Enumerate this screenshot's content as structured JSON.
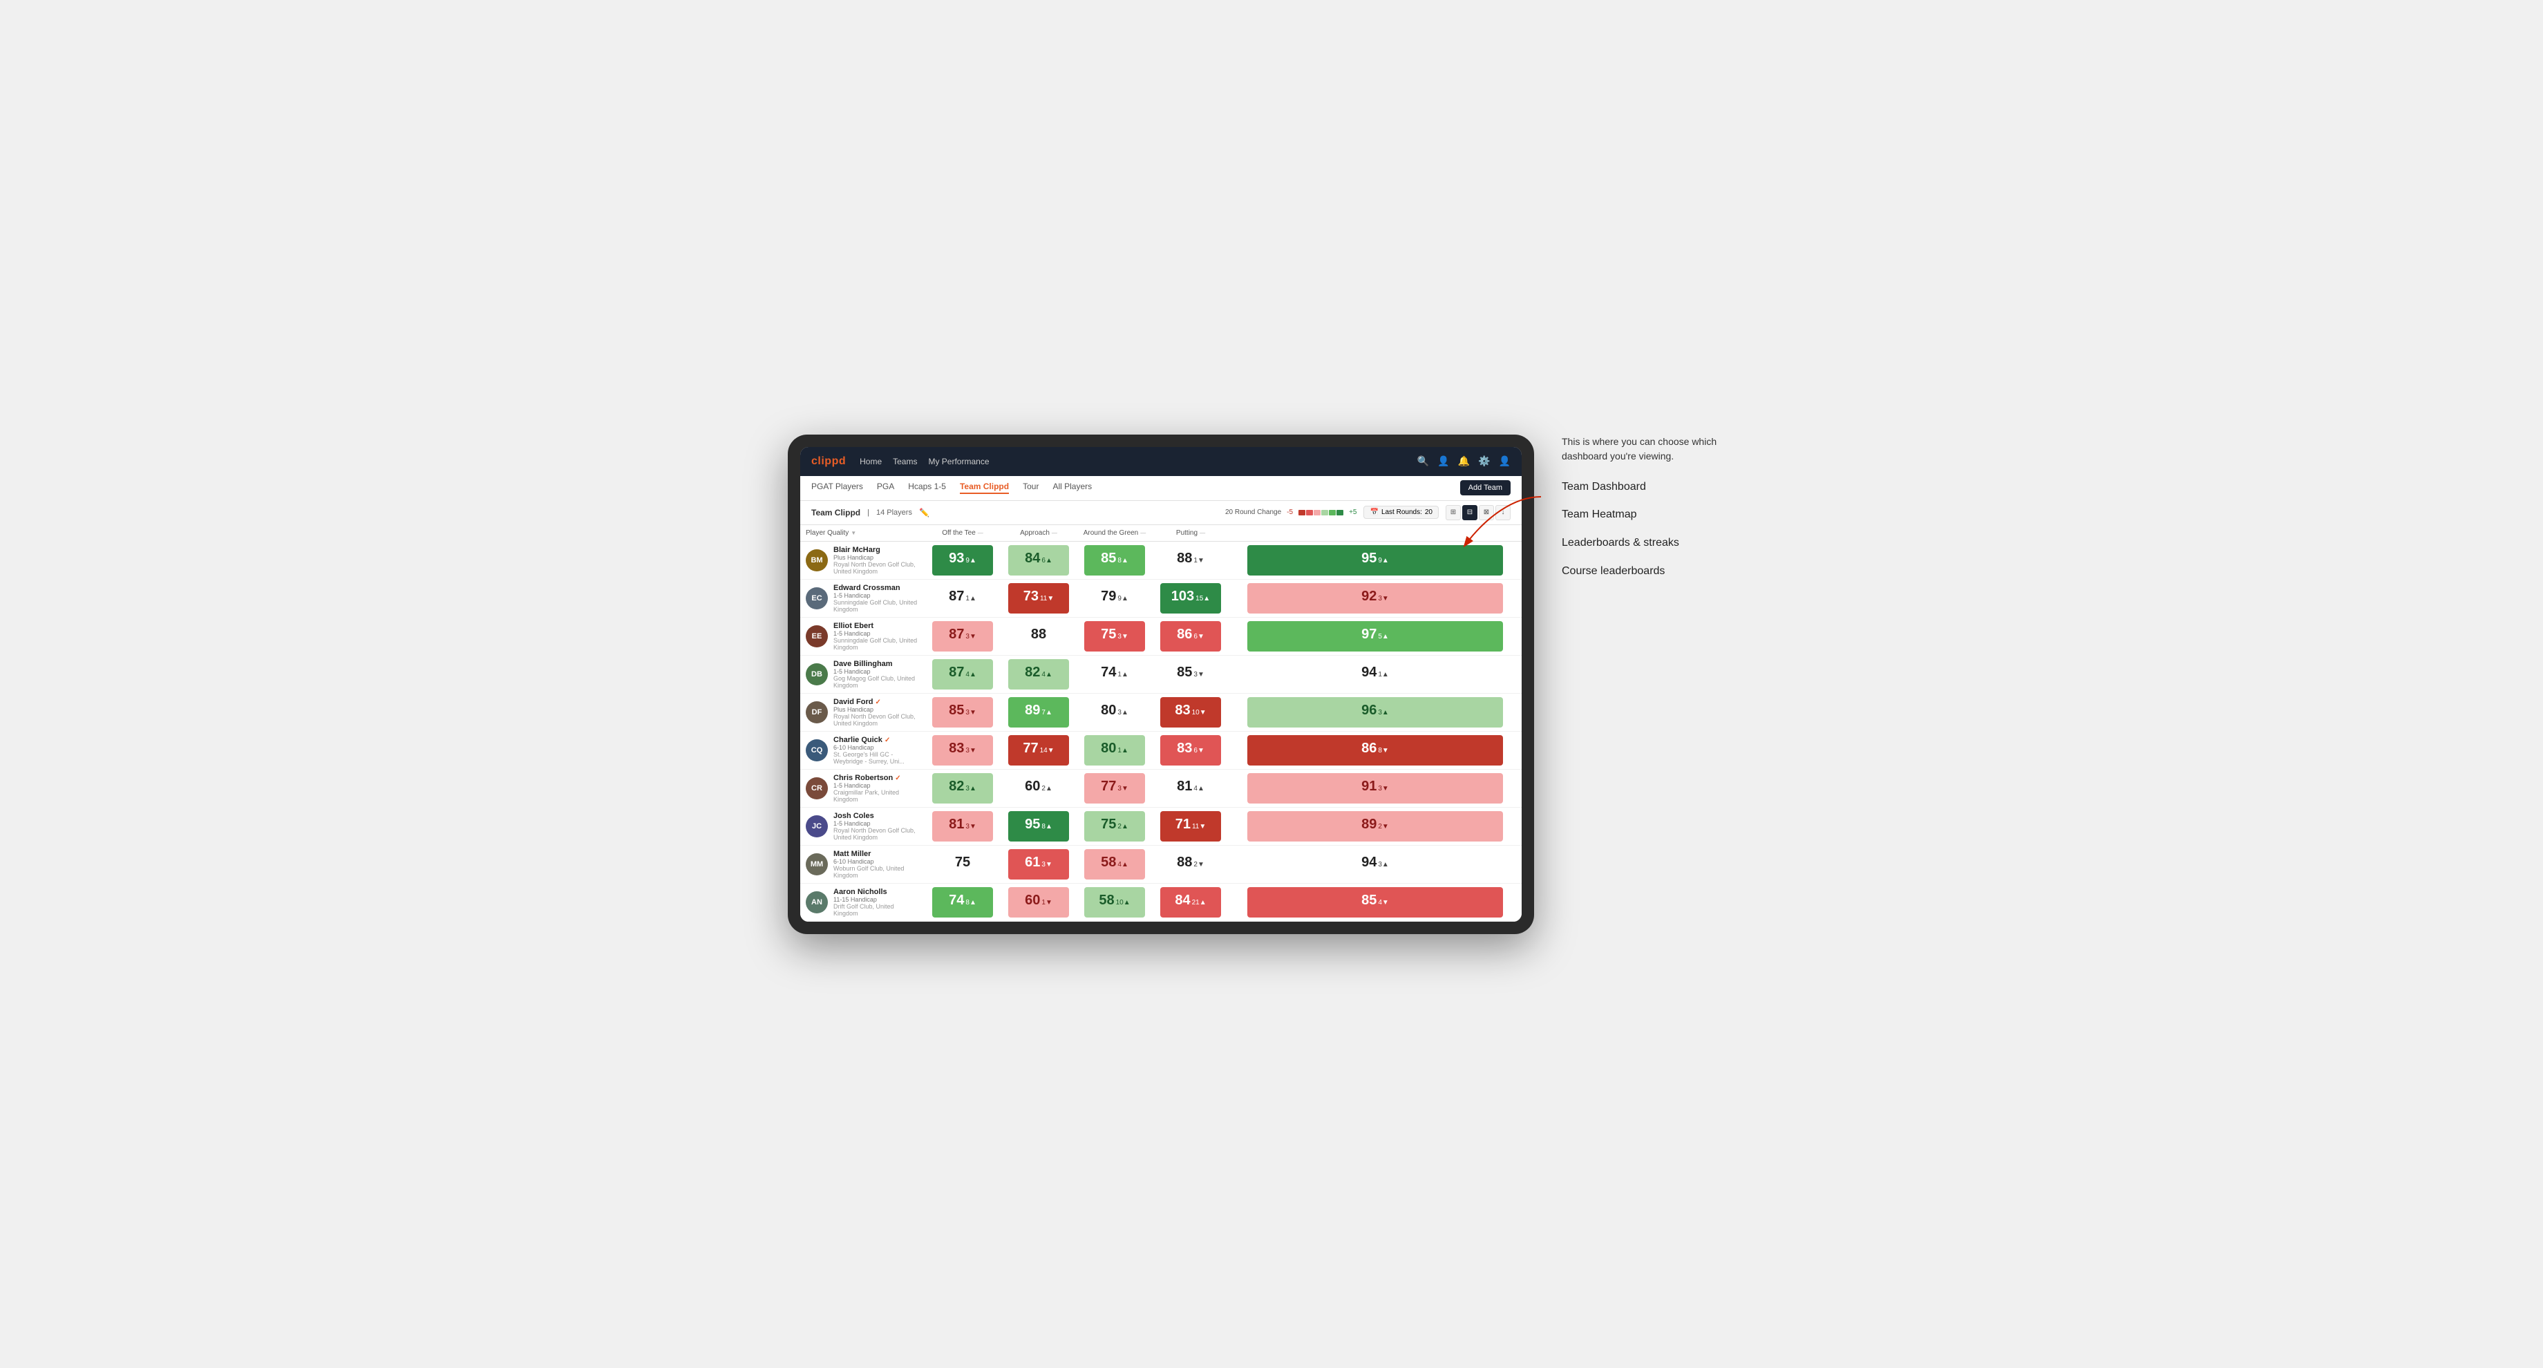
{
  "app": {
    "logo": "clippd",
    "nav": {
      "links": [
        "Home",
        "Teams",
        "My Performance"
      ],
      "icons": [
        "search",
        "user",
        "bell",
        "settings",
        "avatar"
      ]
    },
    "sub_nav": {
      "links": [
        "PGAT Players",
        "PGA",
        "Hcaps 1-5",
        "Team Clippd",
        "Tour",
        "All Players"
      ],
      "active": "Team Clippd",
      "add_button": "Add Team"
    }
  },
  "team_header": {
    "name": "Team Clippd",
    "separator": "|",
    "count": "14 Players",
    "round_change_label": "20 Round Change",
    "round_change_low": "-5",
    "round_change_high": "+5",
    "last_rounds_label": "Last Rounds:",
    "last_rounds_value": "20"
  },
  "table": {
    "columns": [
      {
        "id": "player",
        "label": "Player Quality",
        "sortable": true
      },
      {
        "id": "off_tee",
        "label": "Off the Tee",
        "sortable": true
      },
      {
        "id": "approach",
        "label": "Approach",
        "sortable": true
      },
      {
        "id": "around_green",
        "label": "Around the Green",
        "sortable": true
      },
      {
        "id": "putting",
        "label": "Putting",
        "sortable": true
      }
    ],
    "rows": [
      {
        "name": "Blair McHarg",
        "handicap": "Plus Handicap",
        "club": "Royal North Devon Golf Club, United Kingdom",
        "initials": "BM",
        "avatar_color": "#8B6914",
        "scores": [
          {
            "value": "93",
            "delta": "9",
            "dir": "up",
            "color": "bg-green-strong"
          },
          {
            "value": "84",
            "delta": "6",
            "dir": "up",
            "color": "bg-green-light"
          },
          {
            "value": "85",
            "delta": "8",
            "dir": "up",
            "color": "bg-green-mid"
          },
          {
            "value": "88",
            "delta": "1",
            "dir": "down",
            "color": "bg-white"
          },
          {
            "value": "95",
            "delta": "9",
            "dir": "up",
            "color": "bg-green-strong"
          }
        ]
      },
      {
        "name": "Edward Crossman",
        "handicap": "1-5 Handicap",
        "club": "Sunningdale Golf Club, United Kingdom",
        "initials": "EC",
        "avatar_color": "#5a6a7a",
        "scores": [
          {
            "value": "87",
            "delta": "1",
            "dir": "up",
            "color": "bg-white"
          },
          {
            "value": "73",
            "delta": "11",
            "dir": "down",
            "color": "bg-red-strong"
          },
          {
            "value": "79",
            "delta": "9",
            "dir": "up",
            "color": "bg-white"
          },
          {
            "value": "103",
            "delta": "15",
            "dir": "up",
            "color": "bg-green-strong"
          },
          {
            "value": "92",
            "delta": "3",
            "dir": "down",
            "color": "bg-red-light"
          }
        ]
      },
      {
        "name": "Elliot Ebert",
        "handicap": "1-5 Handicap",
        "club": "Sunningdale Golf Club, United Kingdom",
        "initials": "EE",
        "avatar_color": "#7a3a2a",
        "scores": [
          {
            "value": "87",
            "delta": "3",
            "dir": "down",
            "color": "bg-red-light"
          },
          {
            "value": "88",
            "delta": "",
            "dir": "",
            "color": "bg-white"
          },
          {
            "value": "75",
            "delta": "3",
            "dir": "down",
            "color": "bg-red-mid"
          },
          {
            "value": "86",
            "delta": "6",
            "dir": "down",
            "color": "bg-red-mid"
          },
          {
            "value": "97",
            "delta": "5",
            "dir": "up",
            "color": "bg-green-mid"
          }
        ]
      },
      {
        "name": "Dave Billingham",
        "handicap": "1-5 Handicap",
        "club": "Gog Magog Golf Club, United Kingdom",
        "initials": "DB",
        "avatar_color": "#4a7a4a",
        "scores": [
          {
            "value": "87",
            "delta": "4",
            "dir": "up",
            "color": "bg-green-light"
          },
          {
            "value": "82",
            "delta": "4",
            "dir": "up",
            "color": "bg-green-light"
          },
          {
            "value": "74",
            "delta": "1",
            "dir": "up",
            "color": "bg-white"
          },
          {
            "value": "85",
            "delta": "3",
            "dir": "down",
            "color": "bg-white"
          },
          {
            "value": "94",
            "delta": "1",
            "dir": "up",
            "color": "bg-white"
          }
        ]
      },
      {
        "name": "David Ford",
        "handicap": "Plus Handicap",
        "club": "Royal North Devon Golf Club, United Kingdom",
        "initials": "DF",
        "avatar_color": "#6a5a4a",
        "verified": true,
        "scores": [
          {
            "value": "85",
            "delta": "3",
            "dir": "down",
            "color": "bg-red-light"
          },
          {
            "value": "89",
            "delta": "7",
            "dir": "up",
            "color": "bg-green-mid"
          },
          {
            "value": "80",
            "delta": "3",
            "dir": "up",
            "color": "bg-white"
          },
          {
            "value": "83",
            "delta": "10",
            "dir": "down",
            "color": "bg-red-strong"
          },
          {
            "value": "96",
            "delta": "3",
            "dir": "up",
            "color": "bg-green-light"
          }
        ]
      },
      {
        "name": "Charlie Quick",
        "handicap": "6-10 Handicap",
        "club": "St. George's Hill GC - Weybridge - Surrey, Uni...",
        "initials": "CQ",
        "avatar_color": "#3a5a7a",
        "verified": true,
        "scores": [
          {
            "value": "83",
            "delta": "3",
            "dir": "down",
            "color": "bg-red-light"
          },
          {
            "value": "77",
            "delta": "14",
            "dir": "down",
            "color": "bg-red-strong"
          },
          {
            "value": "80",
            "delta": "1",
            "dir": "up",
            "color": "bg-green-light"
          },
          {
            "value": "83",
            "delta": "6",
            "dir": "down",
            "color": "bg-red-mid"
          },
          {
            "value": "86",
            "delta": "8",
            "dir": "down",
            "color": "bg-red-strong"
          }
        ]
      },
      {
        "name": "Chris Robertson",
        "handicap": "1-5 Handicap",
        "club": "Craigmillar Park, United Kingdom",
        "initials": "CR",
        "avatar_color": "#7a4a3a",
        "verified": true,
        "scores": [
          {
            "value": "82",
            "delta": "3",
            "dir": "up",
            "color": "bg-green-light"
          },
          {
            "value": "60",
            "delta": "2",
            "dir": "up",
            "color": "bg-white"
          },
          {
            "value": "77",
            "delta": "3",
            "dir": "down",
            "color": "bg-red-light"
          },
          {
            "value": "81",
            "delta": "4",
            "dir": "up",
            "color": "bg-white"
          },
          {
            "value": "91",
            "delta": "3",
            "dir": "down",
            "color": "bg-red-light"
          }
        ]
      },
      {
        "name": "Josh Coles",
        "handicap": "1-5 Handicap",
        "club": "Royal North Devon Golf Club, United Kingdom",
        "initials": "JC",
        "avatar_color": "#4a4a8a",
        "scores": [
          {
            "value": "81",
            "delta": "3",
            "dir": "down",
            "color": "bg-red-light"
          },
          {
            "value": "95",
            "delta": "8",
            "dir": "up",
            "color": "bg-green-strong"
          },
          {
            "value": "75",
            "delta": "2",
            "dir": "up",
            "color": "bg-green-light"
          },
          {
            "value": "71",
            "delta": "11",
            "dir": "down",
            "color": "bg-red-strong"
          },
          {
            "value": "89",
            "delta": "2",
            "dir": "down",
            "color": "bg-red-light"
          }
        ]
      },
      {
        "name": "Matt Miller",
        "handicap": "6-10 Handicap",
        "club": "Woburn Golf Club, United Kingdom",
        "initials": "MM",
        "avatar_color": "#6a6a5a",
        "scores": [
          {
            "value": "75",
            "delta": "",
            "dir": "",
            "color": "bg-white"
          },
          {
            "value": "61",
            "delta": "3",
            "dir": "down",
            "color": "bg-red-mid"
          },
          {
            "value": "58",
            "delta": "4",
            "dir": "up",
            "color": "bg-red-light"
          },
          {
            "value": "88",
            "delta": "2",
            "dir": "down",
            "color": "bg-white"
          },
          {
            "value": "94",
            "delta": "3",
            "dir": "up",
            "color": "bg-white"
          }
        ]
      },
      {
        "name": "Aaron Nicholls",
        "handicap": "11-15 Handicap",
        "club": "Drift Golf Club, United Kingdom",
        "initials": "AN",
        "avatar_color": "#5a7a6a",
        "scores": [
          {
            "value": "74",
            "delta": "8",
            "dir": "up",
            "color": "bg-green-mid"
          },
          {
            "value": "60",
            "delta": "1",
            "dir": "down",
            "color": "bg-red-light"
          },
          {
            "value": "58",
            "delta": "10",
            "dir": "up",
            "color": "bg-green-light"
          },
          {
            "value": "84",
            "delta": "21",
            "dir": "up",
            "color": "bg-red-mid"
          },
          {
            "value": "85",
            "delta": "4",
            "dir": "down",
            "color": "bg-red-mid"
          }
        ]
      }
    ]
  },
  "annotation": {
    "intro": "This is where you can choose which dashboard you're viewing.",
    "menu_items": [
      "Team Dashboard",
      "Team Heatmap",
      "Leaderboards & streaks",
      "Course leaderboards"
    ]
  }
}
